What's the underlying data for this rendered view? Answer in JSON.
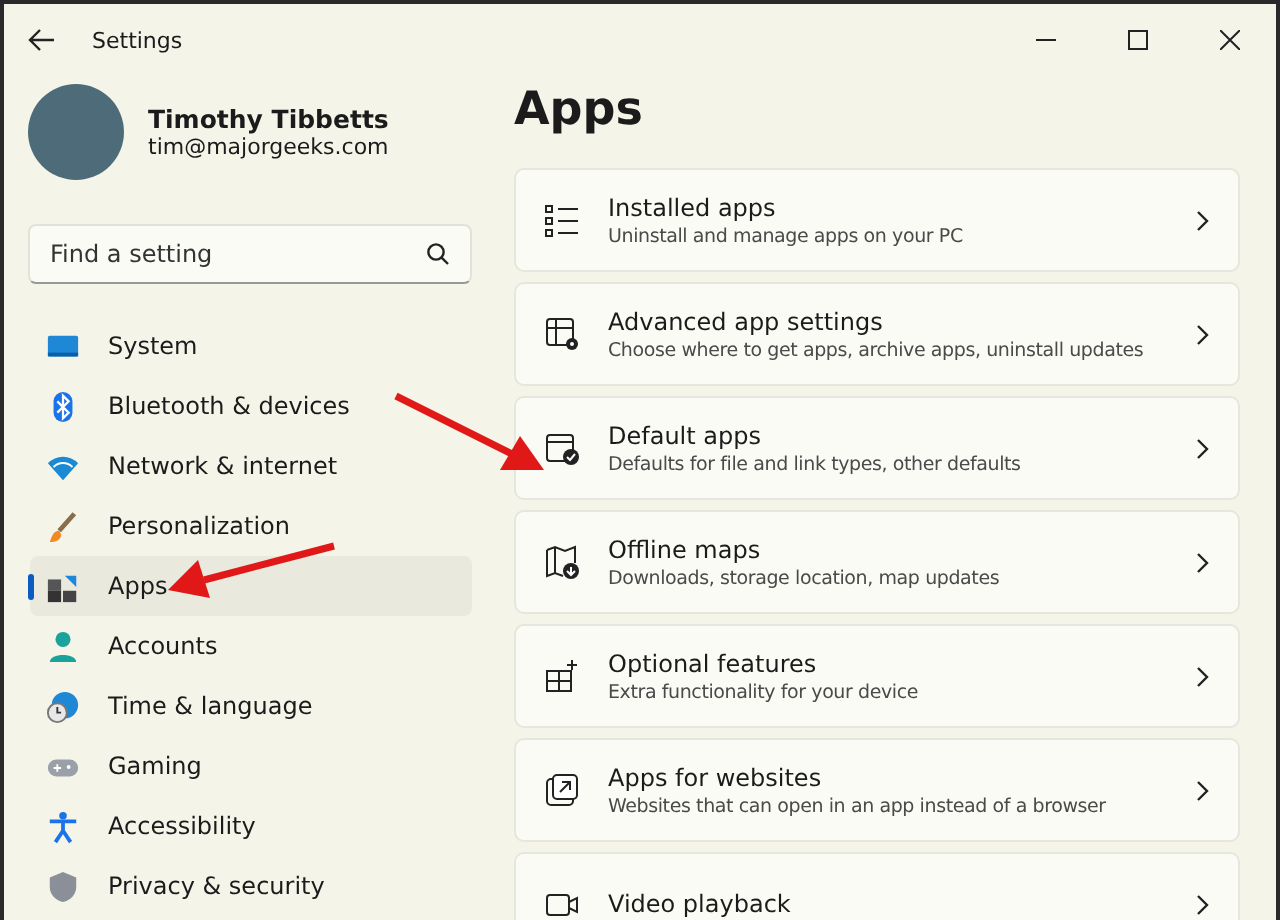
{
  "window": {
    "title": "Settings"
  },
  "user": {
    "name": "Timothy Tibbetts",
    "email": "tim@majorgeeks.com"
  },
  "search": {
    "placeholder": "Find a setting"
  },
  "sidebar": {
    "items": [
      {
        "label": "System",
        "selected": false
      },
      {
        "label": "Bluetooth & devices",
        "selected": false
      },
      {
        "label": "Network & internet",
        "selected": false
      },
      {
        "label": "Personalization",
        "selected": false
      },
      {
        "label": "Apps",
        "selected": true
      },
      {
        "label": "Accounts",
        "selected": false
      },
      {
        "label": "Time & language",
        "selected": false
      },
      {
        "label": "Gaming",
        "selected": false
      },
      {
        "label": "Accessibility",
        "selected": false
      },
      {
        "label": "Privacy & security",
        "selected": false
      }
    ]
  },
  "page": {
    "title": "Apps"
  },
  "cards": [
    {
      "title": "Installed apps",
      "subtitle": "Uninstall and manage apps on your PC"
    },
    {
      "title": "Advanced app settings",
      "subtitle": "Choose where to get apps, archive apps, uninstall updates"
    },
    {
      "title": "Default apps",
      "subtitle": "Defaults for file and link types, other defaults"
    },
    {
      "title": "Offline maps",
      "subtitle": "Downloads, storage location, map updates"
    },
    {
      "title": "Optional features",
      "subtitle": "Extra functionality for your device"
    },
    {
      "title": "Apps for websites",
      "subtitle": "Websites that can open in an app instead of a browser"
    },
    {
      "title": "Video playback"
    }
  ]
}
